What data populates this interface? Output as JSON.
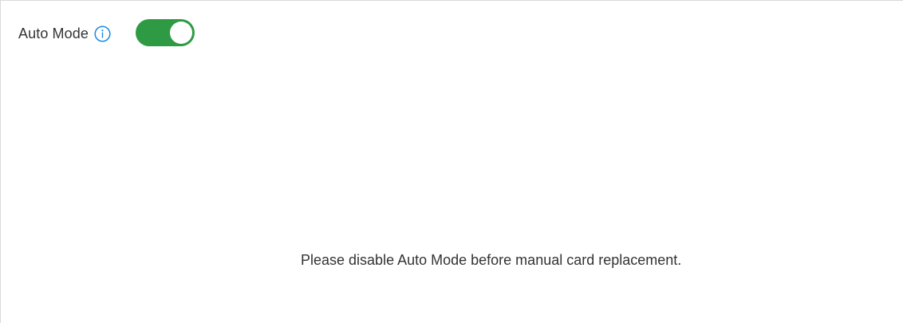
{
  "auto_mode": {
    "label": "Auto Mode",
    "info_icon": "info-circle-icon",
    "toggle_state": "on",
    "toggle_color": "#2e9b44",
    "info_color": "#1e88e5"
  },
  "message": {
    "text": "Please disable Auto Mode before manual card replacement."
  }
}
